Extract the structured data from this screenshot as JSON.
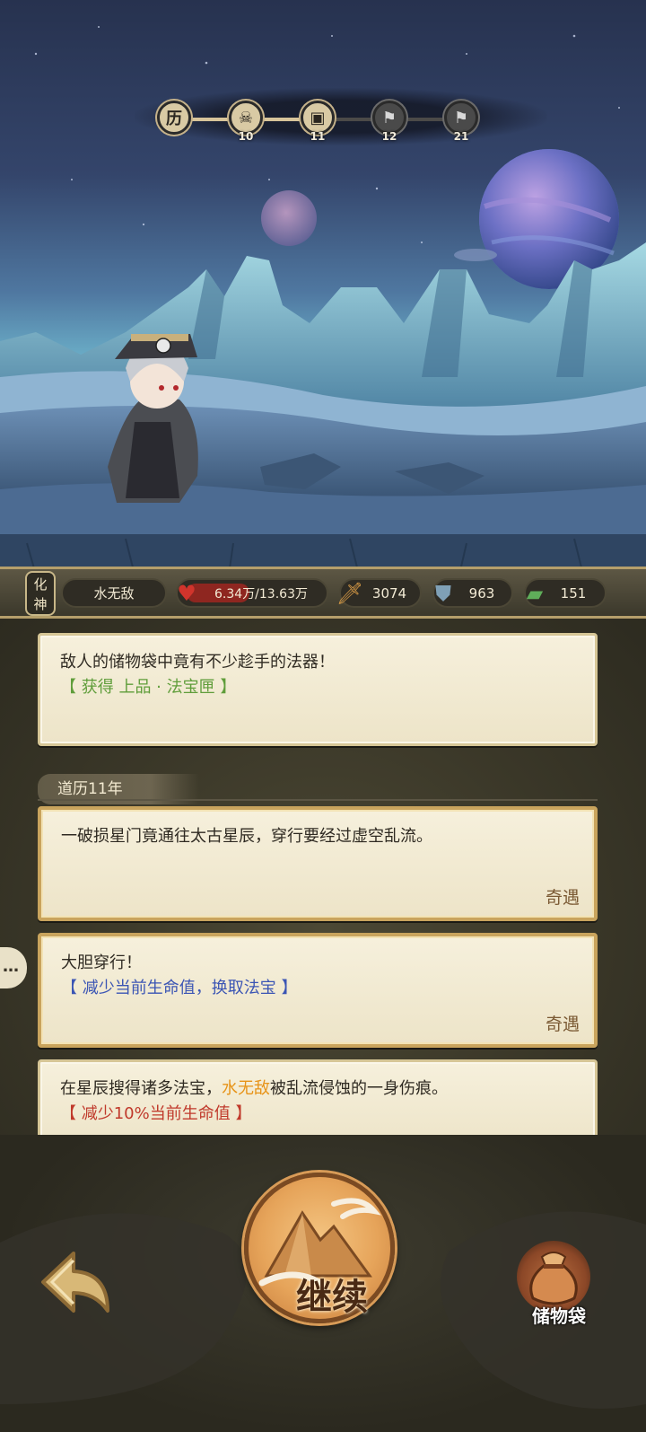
{
  "route": {
    "start_symbol": "历",
    "nodes": [
      {
        "icon": "skull-icon",
        "number": "10"
      },
      {
        "icon": "chest-icon",
        "number": "11"
      },
      {
        "icon": "mystery-icon",
        "number": "12"
      },
      {
        "icon": "mystery-icon",
        "number": "21"
      }
    ],
    "progress_nodes_reached": 2
  },
  "status": {
    "realm_line1": "化",
    "realm_line2": "神",
    "name": "水无敌",
    "hp": "6.34万/13.63万",
    "hp_fraction": 0.465,
    "attack": "3074",
    "defense": "963",
    "speed": "151"
  },
  "log": {
    "entry1": {
      "text": "敌人的储物袋中竟有不少趁手的法器！",
      "reward": "【 获得 上品 · 法宝匣 】"
    },
    "year_label": "道历11年",
    "entry2": {
      "text": "一破损星门竟通往太古星辰，穿行要经过虚空乱流。",
      "tag": "奇遇"
    },
    "entry3": {
      "text": "大胆穿行！",
      "effect": "【 减少当前生命值，换取法宝 】",
      "tag": "奇遇"
    },
    "entry4": {
      "text_before": "在星辰搜得诸多法宝，",
      "name": "水无敌",
      "text_after": "被乱流侵蚀的一身伤痕。",
      "effect": "【 减少10%当前生命值 】"
    }
  },
  "chat_tab": "…",
  "buttons": {
    "continue": "继续",
    "bag": "储物袋"
  },
  "colors": {
    "reward_green": "#5f9d3a",
    "effect_blue": "#3b55b4",
    "damage_red": "#c0392b",
    "name_orange": "#e79318"
  }
}
